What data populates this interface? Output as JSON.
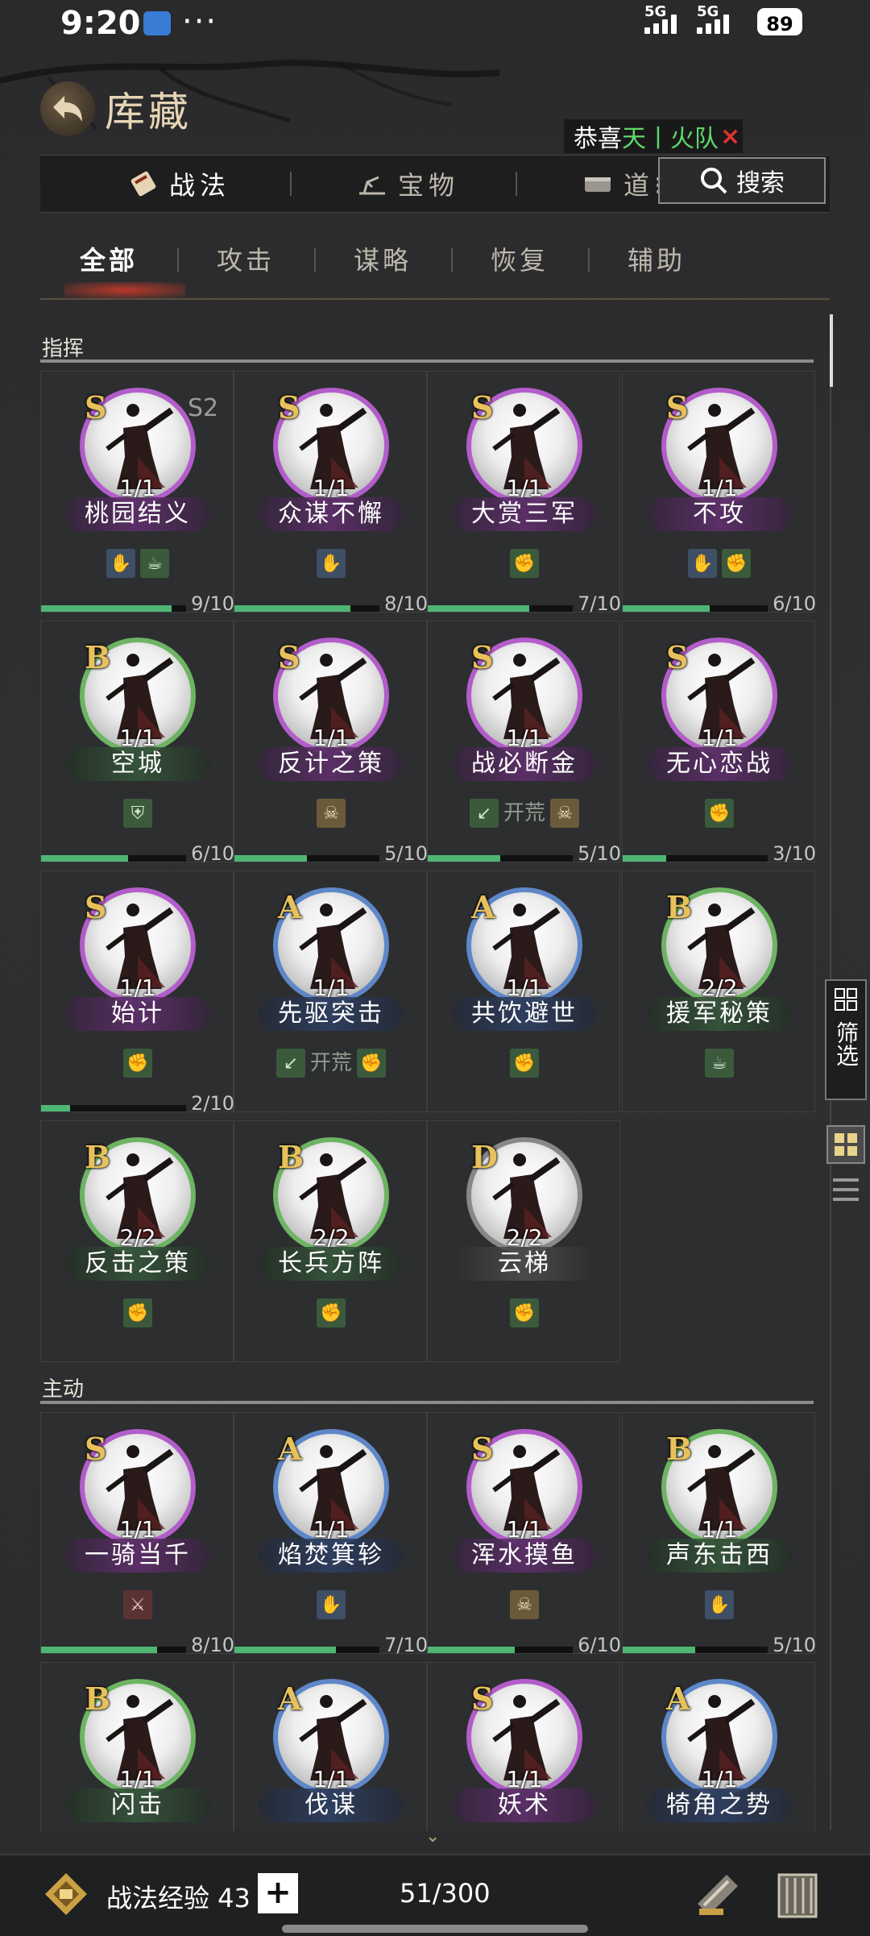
{
  "status": {
    "time": "9:20",
    "dots": "···",
    "net1": "5G",
    "net2": "5G",
    "battery": "89"
  },
  "header": {
    "title": "库藏"
  },
  "notice": {
    "prefix": "恭喜",
    "highlight": "天丨火",
    "tail": "队",
    "close": "×"
  },
  "top_tabs": [
    {
      "label": "战法",
      "active": true
    },
    {
      "label": "宝物",
      "active": false
    },
    {
      "label": "道⁝",
      "active": false
    }
  ],
  "search": {
    "label": "搜索"
  },
  "sub_tabs": [
    {
      "label": "全部",
      "active": true
    },
    {
      "label": "攻击",
      "active": false
    },
    {
      "label": "谋略",
      "active": false
    },
    {
      "label": "恢复",
      "active": false
    },
    {
      "label": "辅助",
      "active": false
    }
  ],
  "sections": [
    {
      "title": "指挥",
      "cards": [
        {
          "grade": "S",
          "season": "S2",
          "count": "1/1",
          "name": "桃园结义",
          "tags": [
            {
              "type": "blue",
              "icon": "✋"
            },
            {
              "type": "green",
              "icon": "☕"
            }
          ],
          "progress": {
            "value": 9,
            "max": 10,
            "text": "9/10"
          }
        },
        {
          "grade": "S",
          "count": "1/1",
          "name": "众谋不懈",
          "tags": [
            {
              "type": "blue",
              "icon": "✋"
            }
          ],
          "progress": {
            "value": 8,
            "max": 10,
            "text": "8/10"
          }
        },
        {
          "grade": "S",
          "count": "1/1",
          "name": "大赏三军",
          "tags": [
            {
              "type": "green",
              "icon": "✊"
            }
          ],
          "progress": {
            "value": 7,
            "max": 10,
            "text": "7/10"
          }
        },
        {
          "grade": "S",
          "count": "1/1",
          "name": "不攻",
          "tags": [
            {
              "type": "blue",
              "icon": "✋"
            },
            {
              "type": "green",
              "icon": "✊"
            }
          ],
          "progress": {
            "value": 6,
            "max": 10,
            "text": "6/10"
          }
        },
        {
          "grade": "B",
          "count": "1/1",
          "name": "空城",
          "tags": [
            {
              "type": "green",
              "icon": "⛨"
            }
          ],
          "progress": {
            "value": 6,
            "max": 10,
            "text": "6/10"
          }
        },
        {
          "grade": "S",
          "count": "1/1",
          "name": "反计之策",
          "tags": [
            {
              "type": "gold",
              "icon": "☠"
            }
          ],
          "progress": {
            "value": 5,
            "max": 10,
            "text": "5/10"
          }
        },
        {
          "grade": "S",
          "count": "1/1",
          "name": "战必断金",
          "tags": [
            {
              "type": "green",
              "icon": "↙"
            },
            {
              "type": "text",
              "text": "开荒"
            },
            {
              "type": "gold",
              "icon": "☠"
            }
          ],
          "progress": {
            "value": 5,
            "max": 10,
            "text": "5/10"
          }
        },
        {
          "grade": "S",
          "count": "1/1",
          "name": "无心恋战",
          "tags": [
            {
              "type": "green",
              "icon": "✊"
            }
          ],
          "progress": {
            "value": 3,
            "max": 10,
            "text": "3/10"
          }
        },
        {
          "grade": "S",
          "count": "1/1",
          "name": "始计",
          "tags": [
            {
              "type": "green",
              "icon": "✊"
            }
          ],
          "progress": {
            "value": 2,
            "max": 10,
            "text": "2/10"
          }
        },
        {
          "grade": "A",
          "count": "1/1",
          "name": "先驱突击",
          "tags": [
            {
              "type": "green",
              "icon": "↙"
            },
            {
              "type": "text",
              "text": "开荒"
            },
            {
              "type": "green",
              "icon": "✊"
            }
          ]
        },
        {
          "grade": "A",
          "count": "1/1",
          "name": "共饮避世",
          "tags": [
            {
              "type": "green",
              "icon": "✊"
            }
          ]
        },
        {
          "grade": "B",
          "count": "2/2",
          "name": "援军秘策",
          "tags": [
            {
              "type": "green",
              "icon": "☕"
            }
          ]
        },
        {
          "grade": "B",
          "count": "2/2",
          "name": "反击之策",
          "tags": [
            {
              "type": "green",
              "icon": "✊"
            }
          ]
        },
        {
          "grade": "B",
          "count": "2/2",
          "name": "长兵方阵",
          "tags": [
            {
              "type": "green",
              "icon": "✊"
            }
          ]
        },
        {
          "grade": "D",
          "count": "2/2",
          "name": "云梯",
          "tags": [
            {
              "type": "green",
              "icon": "✊"
            }
          ]
        }
      ]
    },
    {
      "title": "主动",
      "cards": [
        {
          "grade": "S",
          "count": "1/1",
          "name": "一骑当千",
          "tags": [
            {
              "type": "red",
              "icon": "⚔"
            }
          ],
          "progress": {
            "value": 8,
            "max": 10,
            "text": "8/10"
          }
        },
        {
          "grade": "A",
          "count": "1/1",
          "name": "焰焚箕轸",
          "tags": [
            {
              "type": "blue",
              "icon": "✋"
            }
          ],
          "progress": {
            "value": 7,
            "max": 10,
            "text": "7/10"
          }
        },
        {
          "grade": "S",
          "count": "1/1",
          "name": "浑水摸鱼",
          "tags": [
            {
              "type": "gold",
              "icon": "☠"
            }
          ],
          "progress": {
            "value": 6,
            "max": 10,
            "text": "6/10"
          }
        },
        {
          "grade": "B",
          "count": "1/1",
          "name": "声东击西",
          "tags": [
            {
              "type": "blue",
              "icon": "✋"
            }
          ],
          "progress": {
            "value": 5,
            "max": 10,
            "text": "5/10"
          }
        },
        {
          "grade": "B",
          "count": "1/1",
          "name": "闪击",
          "tags": []
        },
        {
          "grade": "A",
          "count": "1/1",
          "name": "伐谋",
          "tags": []
        },
        {
          "grade": "S",
          "count": "1/1",
          "name": "妖术",
          "tags": []
        },
        {
          "grade": "A",
          "count": "1/1",
          "name": "犄角之势",
          "tags": []
        }
      ]
    }
  ],
  "side": {
    "filter_label": "筛选"
  },
  "bottom": {
    "exp_label": "战法经验 43",
    "plus": "+",
    "capacity": "51/300",
    "arrow": "⌄"
  }
}
